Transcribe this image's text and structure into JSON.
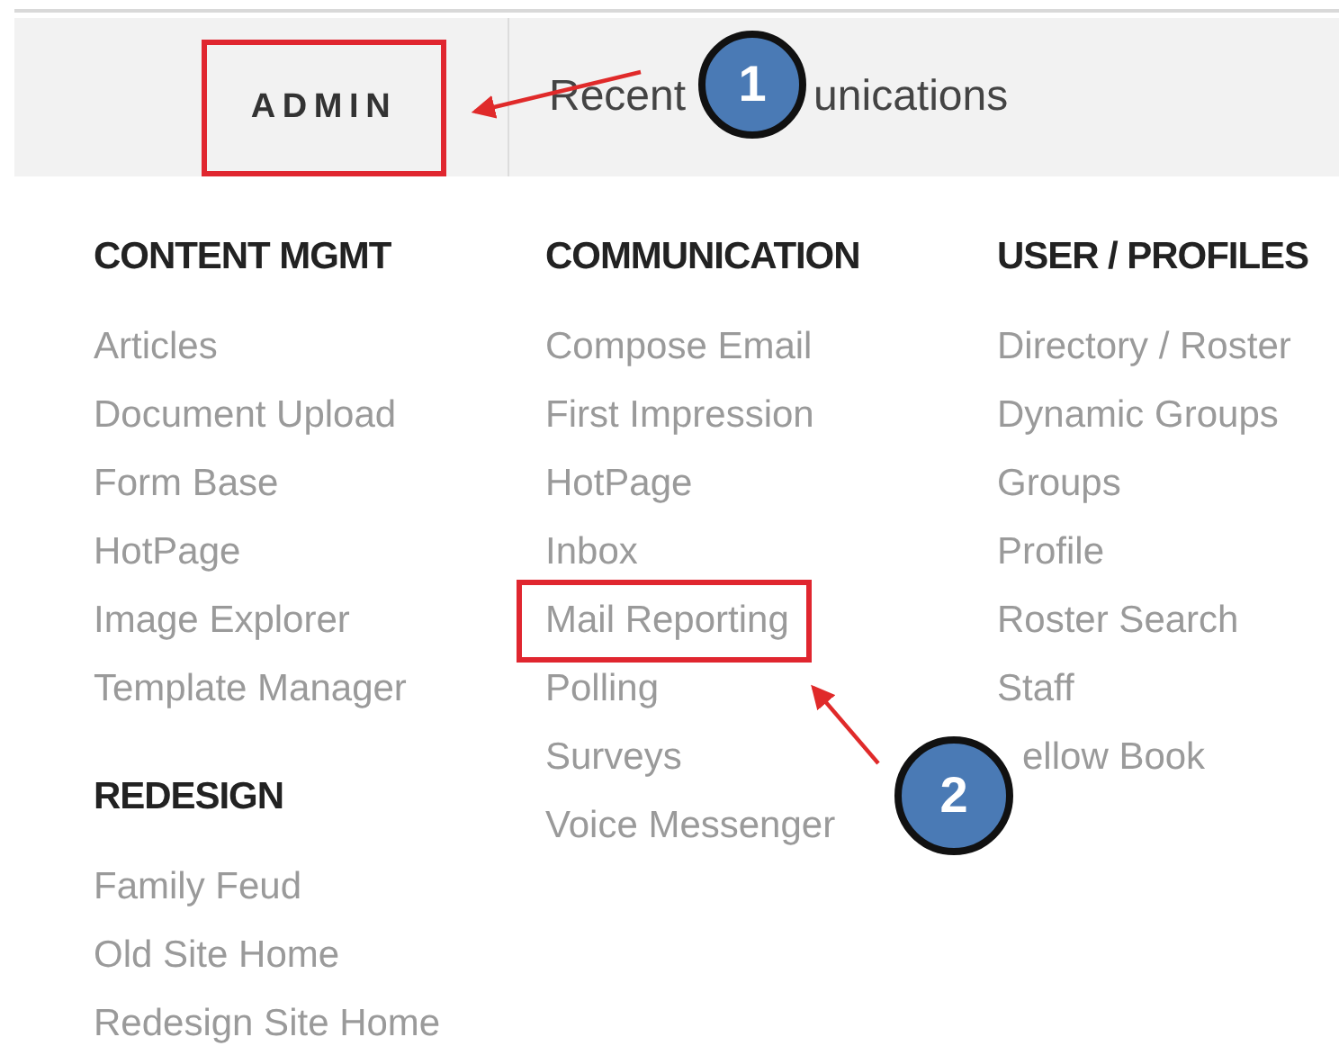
{
  "nav": [
    {
      "kind": "text",
      "label": "ADMIN",
      "highlighted": true
    },
    {
      "kind": "split",
      "parts": [
        "Recent",
        "unications"
      ],
      "highlighted": false
    }
  ],
  "menu": {
    "columns": [
      {
        "sections": [
          {
            "heading": "CONTENT MGMT",
            "items": [
              {
                "kind": "link",
                "label": "Articles",
                "highlighted": false
              },
              {
                "kind": "link",
                "label": "Document Upload",
                "highlighted": false
              },
              {
                "kind": "link",
                "label": "Form Base",
                "highlighted": false
              },
              {
                "kind": "link",
                "label": "HotPage",
                "highlighted": false
              },
              {
                "kind": "link",
                "label": "Image Explorer",
                "highlighted": false
              },
              {
                "kind": "link",
                "label": "Template Manager",
                "highlighted": false
              }
            ]
          },
          {
            "heading": "REDESIGN",
            "items": [
              {
                "kind": "link",
                "label": "Family Feud",
                "highlighted": false
              },
              {
                "kind": "link",
                "label": "Old Site Home",
                "highlighted": false
              },
              {
                "kind": "link",
                "label": "Redesign Site Home",
                "highlighted": false
              }
            ]
          }
        ]
      },
      {
        "sections": [
          {
            "heading": "COMMUNICATION",
            "items": [
              {
                "kind": "link",
                "label": "Compose Email",
                "highlighted": false
              },
              {
                "kind": "link",
                "label": "First Impression",
                "highlighted": false
              },
              {
                "kind": "link",
                "label": "HotPage",
                "highlighted": false
              },
              {
                "kind": "link",
                "label": "Inbox",
                "highlighted": false
              },
              {
                "kind": "link",
                "label": "Mail Reporting",
                "highlighted": true
              },
              {
                "kind": "link",
                "label": "Polling",
                "highlighted": false
              },
              {
                "kind": "link",
                "label": "Surveys",
                "highlighted": false
              },
              {
                "kind": "link",
                "label": "Voice Messenger",
                "highlighted": false
              }
            ]
          }
        ]
      },
      {
        "sections": [
          {
            "heading": "USER / PROFILES",
            "items": [
              {
                "kind": "link",
                "label": "Directory / Roster",
                "highlighted": false
              },
              {
                "kind": "link",
                "label": "Dynamic Groups",
                "highlighted": false
              },
              {
                "kind": "link",
                "label": "Groups",
                "highlighted": false
              },
              {
                "kind": "link",
                "label": "Profile",
                "highlighted": false
              },
              {
                "kind": "link",
                "label": "Roster Search",
                "highlighted": false
              },
              {
                "kind": "link",
                "label": "Staff",
                "highlighted": false
              },
              {
                "kind": "cut",
                "label": "ellow Book",
                "highlighted": false
              }
            ]
          }
        ]
      }
    ]
  },
  "annotations": [
    {
      "number": "1"
    },
    {
      "number": "2"
    }
  ]
}
